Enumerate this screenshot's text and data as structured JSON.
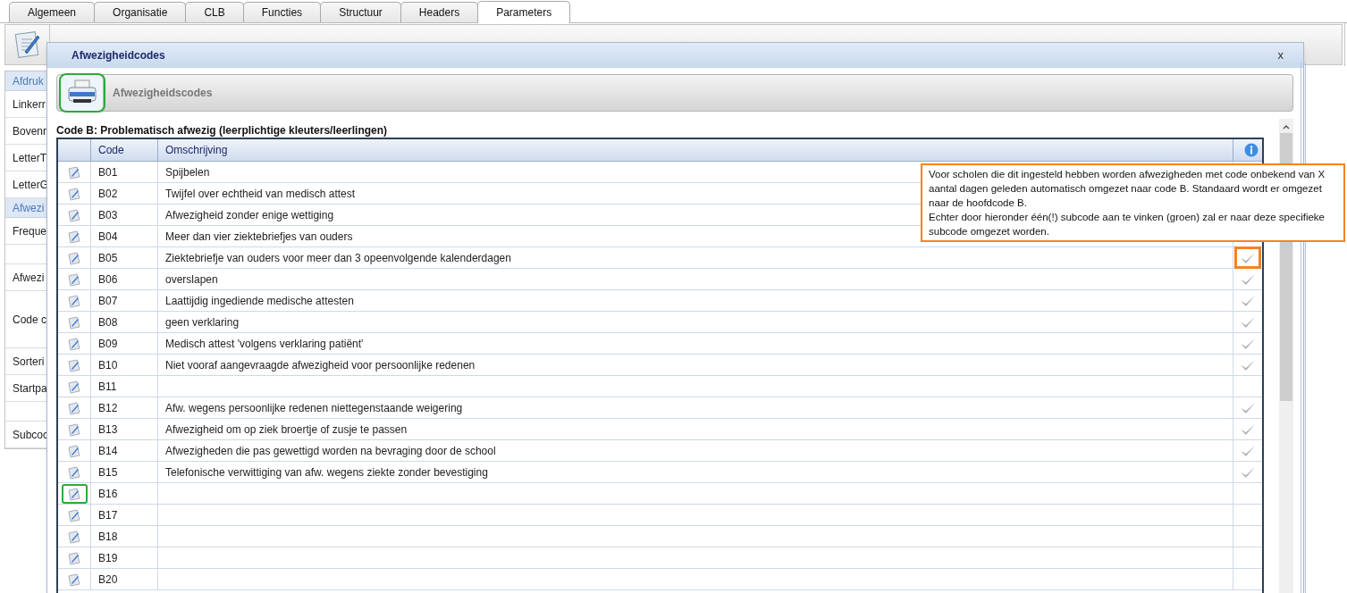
{
  "tabs": [
    {
      "label": "Algemeen",
      "selected": false
    },
    {
      "label": "Organisatie",
      "selected": false
    },
    {
      "label": "CLB",
      "selected": false
    },
    {
      "label": "Functies",
      "selected": false
    },
    {
      "label": "Structuur",
      "selected": false
    },
    {
      "label": "Headers",
      "selected": false
    },
    {
      "label": "Parameters",
      "selected": true
    }
  ],
  "sidebar": {
    "items": [
      {
        "kind": "header",
        "label": "Afdruk"
      },
      {
        "kind": "item",
        "label": "Linkerr"
      },
      {
        "kind": "item",
        "label": "Bovenr"
      },
      {
        "kind": "item",
        "label": "LetterT"
      },
      {
        "kind": "item",
        "label": "LetterG"
      },
      {
        "kind": "header",
        "label": "Afwezi"
      },
      {
        "kind": "item",
        "label": "Freque"
      },
      {
        "kind": "blank"
      },
      {
        "kind": "item",
        "label": "Afwezi"
      },
      {
        "kind": "tall",
        "label": "Code c"
      },
      {
        "kind": "item",
        "label": "Sorteri"
      },
      {
        "kind": "item",
        "label": "Startpa"
      },
      {
        "kind": "blank"
      },
      {
        "kind": "item",
        "label": "Subcoc"
      }
    ]
  },
  "dialog": {
    "title": "Afwezigheidcodes",
    "close": "x",
    "toolbar": {
      "label": "Afwezigheidscodes",
      "print_outlined": true
    },
    "section_title": "Code B: Problematisch afwezig (leerplichtige kleuters/leerlingen)",
    "table": {
      "columns": [
        "Code",
        "Omschrijving"
      ],
      "rows": [
        {
          "code": "B01",
          "description": "Spijbelen",
          "edit_outlined": false
        },
        {
          "code": "B02",
          "description": "Twijfel over echtheid van medisch attest",
          "edit_outlined": false
        },
        {
          "code": "B03",
          "description": "Afwezigheid zonder enige wettiging",
          "edit_outlined": false
        },
        {
          "code": "B04",
          "description": "Meer dan vier ziektebriefjes van ouders",
          "edit_outlined": false
        },
        {
          "code": "B05",
          "description": "Ziektebriefje van ouders voor meer dan 3 opeenvolgende kalenderdagen",
          "checkmark": true,
          "edit_outlined": false,
          "check_outlined": true
        },
        {
          "code": "B06",
          "description": "overslapen",
          "checkmark": true,
          "edit_outlined": false,
          "check_outlined": false
        },
        {
          "code": "B07",
          "description": "Laattijdig ingediende medische attesten",
          "checkmark": true,
          "edit_outlined": false,
          "check_outlined": false
        },
        {
          "code": "B08",
          "description": "geen verklaring",
          "checkmark": true,
          "edit_outlined": false,
          "check_outlined": false
        },
        {
          "code": "B09",
          "description": "Medisch attest 'volgens verklaring patiënt'",
          "checkmark": true,
          "edit_outlined": false,
          "check_outlined": false
        },
        {
          "code": "B10",
          "description": "Niet vooraf aangevraagde afwezigheid voor persoonlijke redenen",
          "checkmark": true,
          "edit_outlined": false,
          "check_outlined": false
        },
        {
          "code": "B11",
          "checkmark": false,
          "edit_outlined": false,
          "check_outlined": false
        },
        {
          "code": "B12",
          "description": "Afw. wegens persoonlijke redenen niettegenstaande weigering",
          "checkmark": true,
          "edit_outlined": false,
          "check_outlined": false
        },
        {
          "code": "B13",
          "description": "Afwezigheid om op ziek broertje of zusje te passen",
          "checkmark": true,
          "edit_outlined": false,
          "check_outlined": false
        },
        {
          "code": "B14",
          "description": "Afwezigheden die pas gewettigd worden na bevraging door de school",
          "checkmark": true,
          "edit_outlined": false,
          "check_outlined": false
        },
        {
          "code": "B15",
          "description": "Telefonische verwittiging van afw. wegens ziekte zonder bevestiging",
          "checkmark": true,
          "edit_outlined": false,
          "check_outlined": false
        },
        {
          "code": "B16",
          "checkmark": false,
          "edit_outlined": true,
          "check_outlined": false
        },
        {
          "code": "B17",
          "checkmark": false,
          "edit_outlined": false,
          "check_outlined": false
        },
        {
          "code": "B18",
          "checkmark": false,
          "edit_outlined": false,
          "check_outlined": false
        },
        {
          "code": "B19",
          "checkmark": false,
          "edit_outlined": false,
          "check_outlined": false
        },
        {
          "code": "B20",
          "checkmark": false,
          "edit_outlined": false,
          "check_outlined": false
        }
      ]
    },
    "tooltip": "Voor scholen die dit ingesteld hebben worden afwezigheden met code onbekend van X aantal dagen geleden automatisch omgezet naar code B.  Standaard wordt er omgezet naar de hoofdcode B.\nEchter door hieronder één(!) subcode aan te vinken (groen) zal er naar deze specifieke subcode omgezet worden."
  }
}
